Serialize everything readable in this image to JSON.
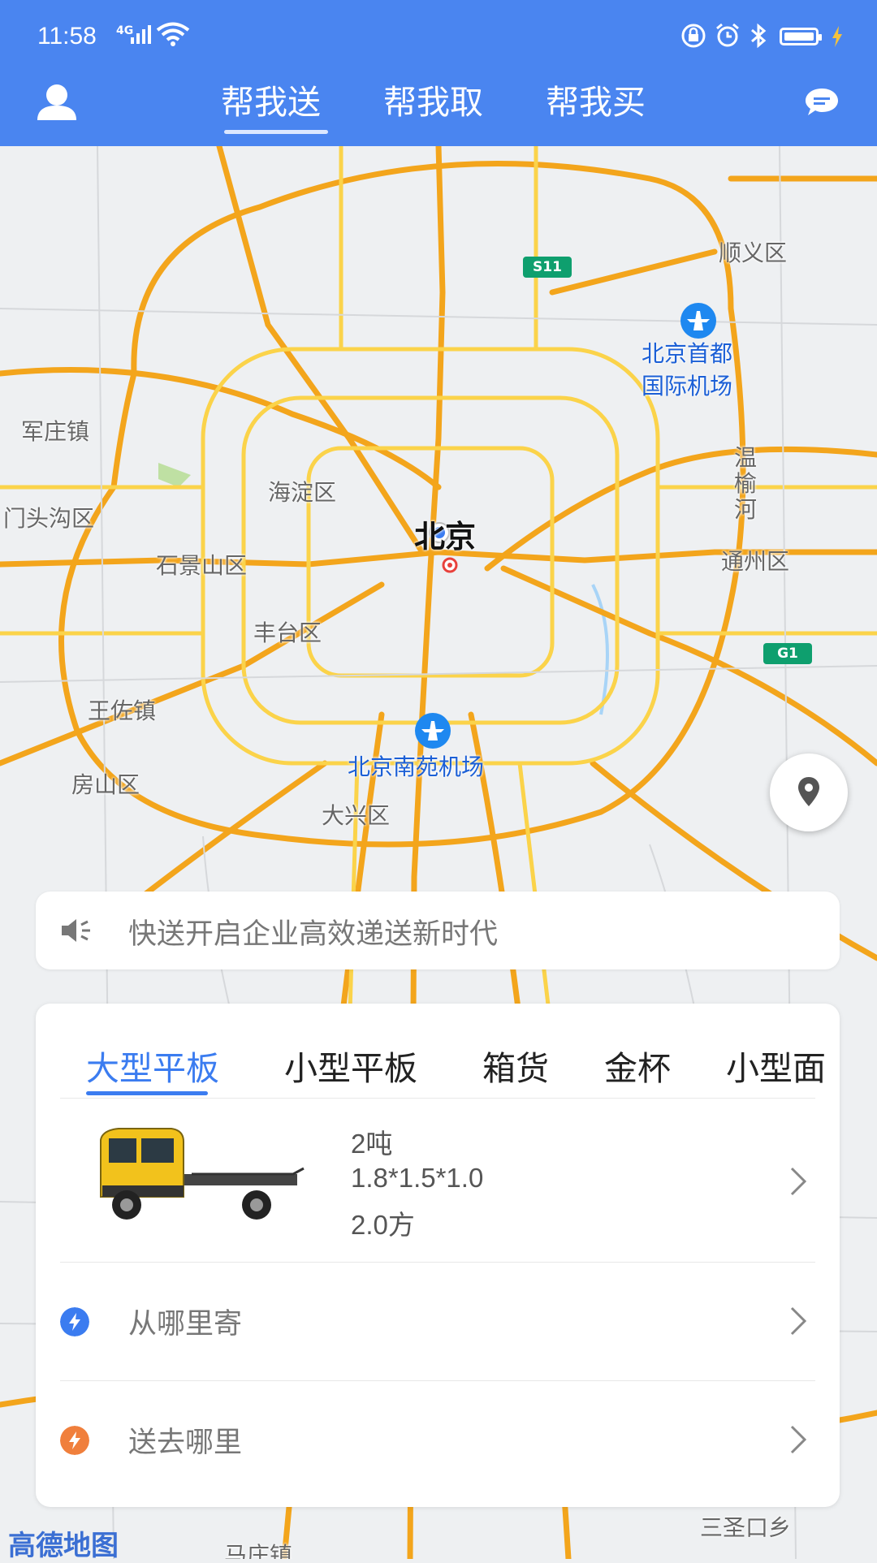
{
  "status_bar": {
    "time": "11:58",
    "network": "4G"
  },
  "top_tabs": [
    {
      "label": "帮我送",
      "active": true
    },
    {
      "label": "帮我取",
      "active": false
    },
    {
      "label": "帮我买",
      "active": false
    }
  ],
  "map": {
    "labels": {
      "shunyi": "顺义区",
      "capital_airport_1": "北京首都",
      "capital_airport_2": "国际机场",
      "junzhuang": "军庄镇",
      "haidian": "海淀区",
      "beijing": "北京",
      "mentougou": "门头沟区",
      "shijingshan": "石景山区",
      "wenyuhe": "温榆河",
      "tongzhou": "通州区",
      "fengtai": "丰台区",
      "wangzuo": "王佐镇",
      "nanyuan_airport": "北京南苑机场",
      "fangshan": "房山区",
      "daxing": "大兴区",
      "sanshengkou": "三圣口乡",
      "mazhuang": "马庄镇",
      "attribution": "高德地图"
    },
    "badges": {
      "s11": "S11",
      "g1": "G1"
    }
  },
  "notice": {
    "text": "快送开启企业高效递送新时代"
  },
  "vehicle_tabs": [
    {
      "label": "大型平板",
      "active": true
    },
    {
      "label": "小型平板",
      "active": false
    },
    {
      "label": "箱货",
      "active": false
    },
    {
      "label": "金杯",
      "active": false
    },
    {
      "label": "小型面",
      "active": false
    }
  ],
  "vehicle": {
    "weight": "2吨",
    "size": "1.8*1.5*1.0",
    "volume": "2.0方"
  },
  "addresses": {
    "from_placeholder": "从哪里寄",
    "to_placeholder": "送去哪里"
  },
  "colors": {
    "brand": "#4a85f0",
    "accent_blue": "#3b7cf0",
    "accent_orange": "#f07f3c",
    "road": "#f5b522"
  }
}
